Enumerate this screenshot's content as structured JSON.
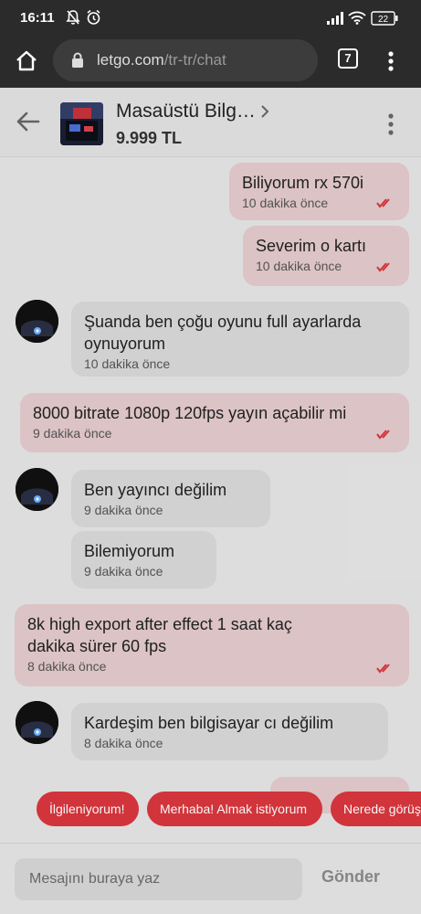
{
  "status_bar": {
    "time": "16:11",
    "battery": "22"
  },
  "browser": {
    "url_host": "letgo.com",
    "url_path": "/tr-tr/chat",
    "tab_count": "7"
  },
  "product": {
    "title": "Masaüstü Bilg…",
    "price": "9.999 TL"
  },
  "messages": [
    {
      "dir": "out",
      "text": "Biliyorum rx 570i",
      "time": "10 dakika önce",
      "read": true
    },
    {
      "dir": "out",
      "text": "Severim o kartı",
      "time": "10 dakika önce",
      "read": true
    },
    {
      "dir": "in",
      "text": "Şuanda ben çoğu oyunu full ayarlarda oynuyorum",
      "time": "10 dakika önce"
    },
    {
      "dir": "out",
      "text": "8000 bitrate 1080p 120fps yayın açabilir mi",
      "time": "9 dakika önce",
      "read": true
    },
    {
      "dir": "in",
      "text": "Ben yayıncı değilim",
      "time": "9 dakika önce"
    },
    {
      "dir": "in",
      "text": "Bilemiyorum",
      "time": "9 dakika önce"
    },
    {
      "dir": "out",
      "text": "8k high export after effect 1 saat kaç dakika sürer 60 fps",
      "time": "8 dakika önce",
      "read": true
    },
    {
      "dir": "in",
      "text": "Kardeşim ben bilgisayar cı değilim",
      "time": "8 dakika önce"
    }
  ],
  "quick_replies": [
    "İlgileniyorum!",
    "Merhaba! Almak istiyorum",
    "Nerede görüş"
  ],
  "composer": {
    "placeholder": "Mesajını buraya yaz",
    "send_label": "Gönder"
  },
  "colors": {
    "accent": "#d9363e",
    "outgoing_bubble": "#e5cbcd",
    "incoming_bubble": "#d9d9d9",
    "browser_chrome": "#2b2b2b"
  }
}
